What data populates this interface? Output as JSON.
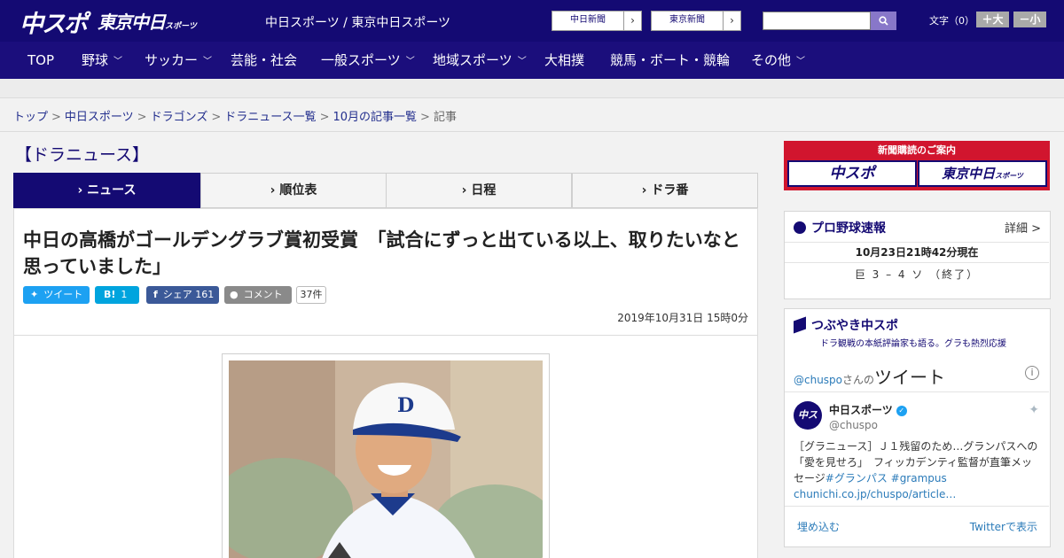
{
  "header": {
    "logo_chuspo": "中スポ",
    "logo_tokyo": "東京中日",
    "logo_tokyo_small": "スポーツ",
    "tagline": "中日スポーツ / 東京中日スポーツ",
    "paper_links": [
      {
        "label": "中日新聞",
        "arrow": "›"
      },
      {
        "label": "東京新聞",
        "arrow": "›"
      }
    ],
    "search_placeholder": "",
    "fontsize_label": "文字（0）",
    "fontsize_up": "＋大",
    "fontsize_down": "－小"
  },
  "nav": {
    "items": [
      {
        "label": "TOP",
        "chevron": ""
      },
      {
        "label": "野球",
        "chevron": "﹀"
      },
      {
        "label": "サッカー",
        "chevron": "﹀"
      },
      {
        "label": "芸能・社会",
        "chevron": ""
      },
      {
        "label": "一般スポーツ",
        "chevron": "﹀"
      },
      {
        "label": "地域スポーツ",
        "chevron": "﹀"
      },
      {
        "label": "大相撲",
        "chevron": ""
      },
      {
        "label": "競馬・ボート・競輪",
        "chevron": ""
      },
      {
        "label": "その他",
        "chevron": "﹀"
      }
    ]
  },
  "breadcrumb": {
    "items": [
      "トップ",
      "中日スポーツ",
      "ドラゴンズ",
      "ドラニュース一覧",
      "10月の記事一覧"
    ],
    "current": "記事",
    "separator": ">"
  },
  "section_title": "【ドラニュース】",
  "tabs": [
    {
      "label": "ニュース",
      "active": true
    },
    {
      "label": "順位表",
      "active": false
    },
    {
      "label": "日程",
      "active": false
    },
    {
      "label": "ドラ番",
      "active": false
    }
  ],
  "tab_arrow": "›",
  "article": {
    "headline": "中日の高橋がゴールデングラブ賞初受賞　「試合にずっと出ている以上、取りたいなと思っていました」",
    "share": {
      "tweet_icon": "🐦",
      "tweet_label": "ツイート",
      "hatena_icon": "B!",
      "hatena_count": "1",
      "facebook_icon": "f",
      "facebook_label": "シェア",
      "facebook_count": "161",
      "comment_label": "コメント",
      "comment_count": "37件"
    },
    "date": "2019年10月31日 15時0分"
  },
  "sidebar": {
    "subscribe_title": "新聞購読のご案内",
    "subscribe_chuspo": "中スポ",
    "subscribe_tokyo": "東京中日",
    "subscribe_tokyo_small": "スポーツ",
    "baseball": {
      "title": "プロ野球速報",
      "detail": "詳細 >",
      "updated": "10月23日21時42分現在",
      "score": "巨 3 – 4 ソ （終了）"
    },
    "tsubuyaki": {
      "title": "つぶやき中スポ",
      "subtitle": "ドラ観戦の本紙評論家も語る。グラも熱烈応援",
      "account": "@chuspo",
      "san": "さんの",
      "tweet_word": "ツイート",
      "info": "i",
      "avatar_text": "中スポ",
      "name": "中日スポーツ",
      "verified": "✓",
      "handle": "@chuspo",
      "tweet_text": "［グラニュース］Ｊ１残留のため…グランパスへの「愛を見せろ」　フィッカデンティ監督が直筆メッセージ",
      "tweet_tags": "#グランパス #grampus",
      "tweet_link": "chunichi.co.jp/chuspo/article…",
      "embed": "埋め込む",
      "view": "Twitterで表示"
    }
  },
  "colors": {
    "brand_navy": "#140a73",
    "twitter_blue": "#1da1f2",
    "hatena_blue": "#00a4de",
    "facebook_blue": "#3b5998",
    "subscribe_red": "#d1152e"
  }
}
